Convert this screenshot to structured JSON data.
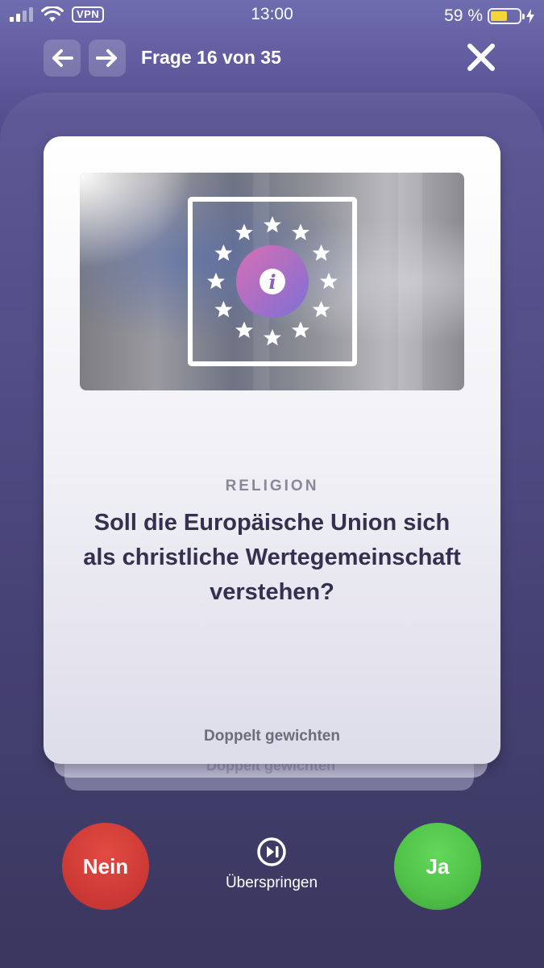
{
  "status_bar": {
    "time": "13:00",
    "vpn": "VPN",
    "battery": "59 %",
    "battery_level": 0.59
  },
  "header": {
    "title": "Frage 16 von 35",
    "back_icon": "arrow-left-icon",
    "forward_icon": "arrow-right-icon",
    "close_icon": "close-icon"
  },
  "card": {
    "category": "RELIGION",
    "question": "Soll die Europäische Union sich als christliche Wertegemeinschaft verstehen?",
    "double_weight": "Doppelt gewichten",
    "info_icon": "info-icon"
  },
  "stack_card": {
    "ghost_text": "Doppelt gewichten"
  },
  "actions": {
    "no": "Nein",
    "yes": "Ja",
    "skip": "Überspringen",
    "colors": {
      "no": "#d23c38",
      "yes": "#55c84d"
    }
  }
}
